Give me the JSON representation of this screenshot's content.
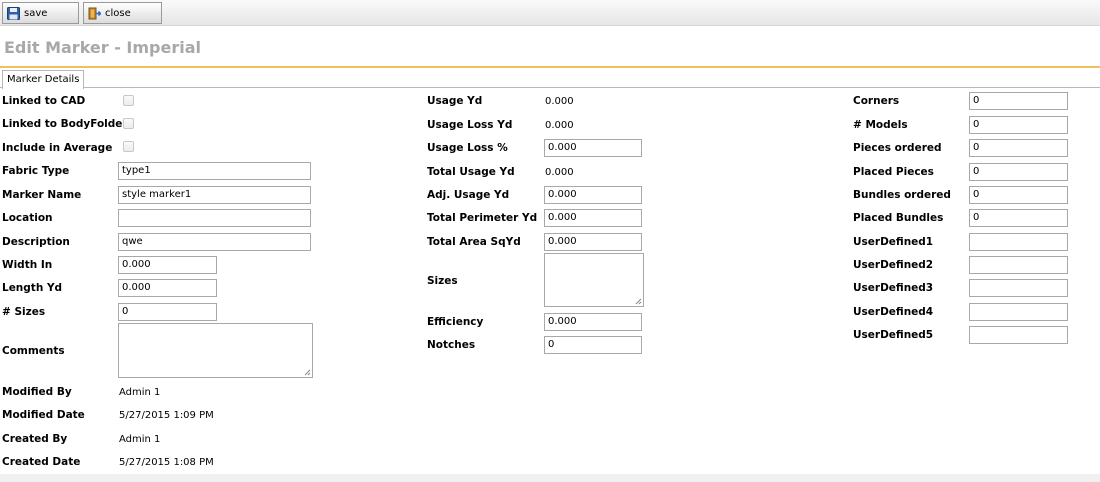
{
  "toolbar": {
    "save_label": "save",
    "close_label": "close"
  },
  "page_title": "Edit Marker - Imperial",
  "tab_label": "Marker Details",
  "col1": {
    "linked_cad": "Linked to CAD",
    "linked_bodyfolder": "Linked to BodyFolder",
    "include_average": "Include in Average",
    "fabric_type": {
      "label": "Fabric Type",
      "value": "type1"
    },
    "marker_name": {
      "label": "Marker Name",
      "value": "style marker1"
    },
    "location": {
      "label": "Location",
      "value": ""
    },
    "description": {
      "label": "Description",
      "value": "qwe"
    },
    "width_in": {
      "label": "Width In",
      "value": "0.000"
    },
    "length_yd": {
      "label": "Length Yd",
      "value": "0.000"
    },
    "num_sizes": {
      "label": "# Sizes",
      "value": "0"
    },
    "comments": {
      "label": "Comments",
      "value": ""
    },
    "modified_by": {
      "label": "Modified By",
      "value": "Admin 1"
    },
    "modified_date": {
      "label": "Modified Date",
      "value": "5/27/2015 1:09 PM"
    },
    "created_by": {
      "label": "Created By",
      "value": "Admin 1"
    },
    "created_date": {
      "label": "Created Date",
      "value": "5/27/2015 1:08 PM"
    }
  },
  "col2": {
    "usage_yd": {
      "label": "Usage Yd",
      "value": "0.000"
    },
    "usage_loss_yd": {
      "label": "Usage Loss Yd",
      "value": "0.000"
    },
    "usage_loss_pct": {
      "label": "Usage Loss %",
      "value": "0.000"
    },
    "total_usage_yd": {
      "label": "Total Usage Yd",
      "value": "0.000"
    },
    "adj_usage_yd": {
      "label": "Adj. Usage Yd",
      "value": "0.000"
    },
    "total_perimeter_yd": {
      "label": "Total Perimeter Yd",
      "value": "0.000"
    },
    "total_area_sqyd": {
      "label": "Total Area SqYd",
      "value": "0.000"
    },
    "sizes": {
      "label": "Sizes",
      "value": ""
    },
    "efficiency": {
      "label": "Efficiency",
      "value": "0.000"
    },
    "notches": {
      "label": "Notches",
      "value": "0"
    }
  },
  "col3": {
    "corners": {
      "label": "Corners",
      "value": "0"
    },
    "models": {
      "label": "# Models",
      "value": "0"
    },
    "pieces_ordered": {
      "label": "Pieces ordered",
      "value": "0"
    },
    "placed_pieces": {
      "label": "Placed Pieces",
      "value": "0"
    },
    "bundles_ordered": {
      "label": "Bundles ordered",
      "value": "0"
    },
    "placed_bundles": {
      "label": "Placed Bundles",
      "value": "0"
    },
    "ud1": {
      "label": "UserDefined1",
      "value": ""
    },
    "ud2": {
      "label": "UserDefined2",
      "value": ""
    },
    "ud3": {
      "label": "UserDefined3",
      "value": ""
    },
    "ud4": {
      "label": "UserDefined4",
      "value": ""
    },
    "ud5": {
      "label": "UserDefined5",
      "value": ""
    }
  },
  "icons": {
    "save": "floppy-disk-icon",
    "close": "close-door-icon"
  },
  "colors": {
    "title": "#a8a8a8",
    "tab_accent": "#f0c060"
  }
}
